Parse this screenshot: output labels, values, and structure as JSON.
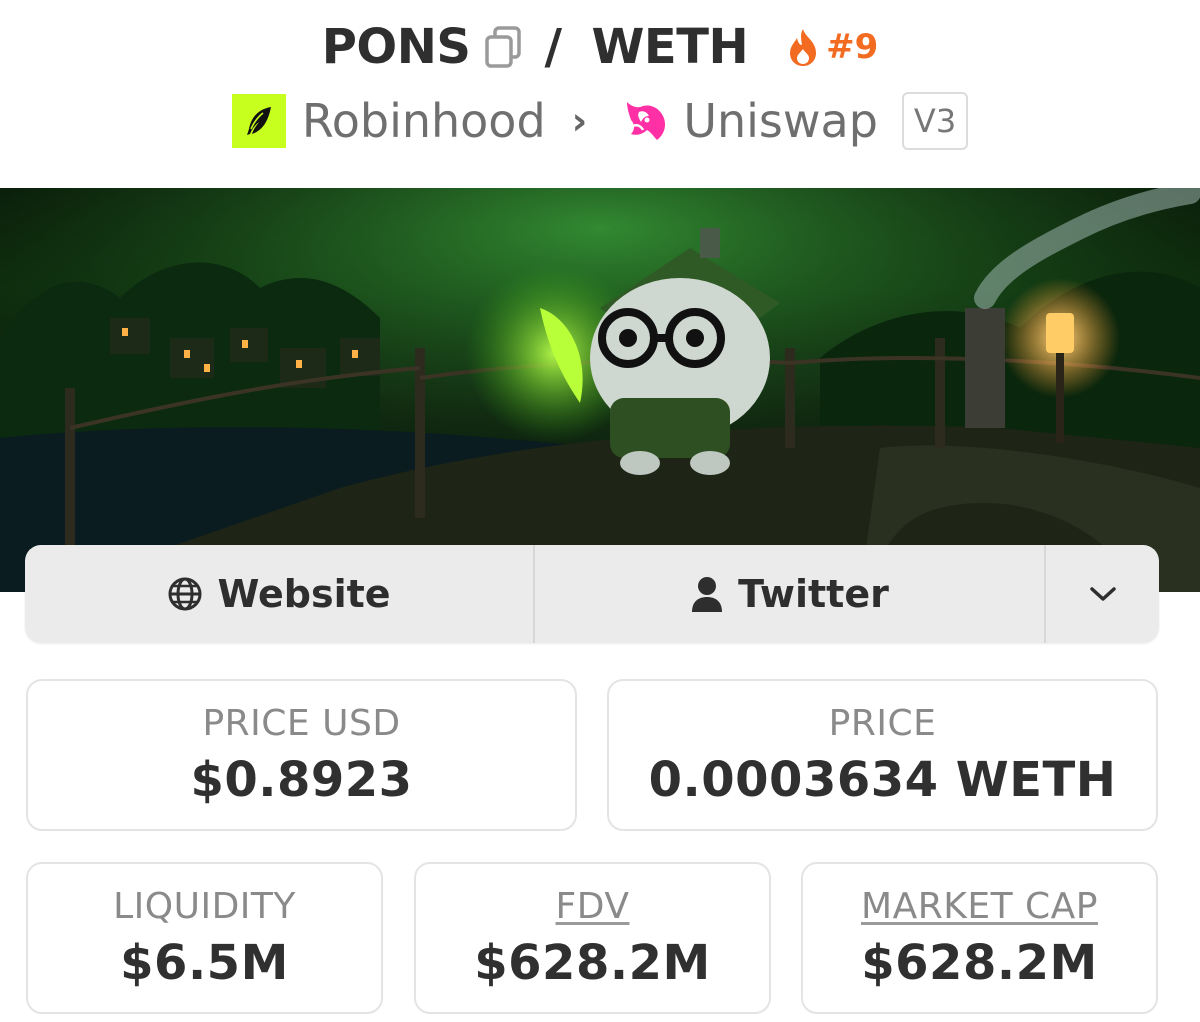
{
  "header": {
    "base_token": "PONS",
    "separator": "/",
    "quote_token": "WETH",
    "rank": "#9",
    "icons": {
      "copy": "copy-icon",
      "trending": "flame-icon"
    },
    "colors": {
      "rank": "#f26b21"
    }
  },
  "breadcrumb": {
    "chain": "Robinhood",
    "chain_logo": "robinhood-feather-logo",
    "dex": "Uniswap",
    "dex_logo": "uniswap-unicorn-logo",
    "version": "V3",
    "colors": {
      "chain_logo_bg": "#c7ff1f",
      "dex_logo": "#ff2fa6"
    }
  },
  "links": {
    "website_label": "Website",
    "website_icon": "globe-icon",
    "twitter_label": "Twitter",
    "twitter_icon": "user-icon",
    "more_icon": "chevron-down-icon"
  },
  "stats": {
    "price_usd": {
      "label": "PRICE USD",
      "value": "$0.8923"
    },
    "price": {
      "label": "PRICE",
      "value": "0.0003634 WETH"
    },
    "liquidity": {
      "label": "LIQUIDITY",
      "value": "$6.5M"
    },
    "fdv": {
      "label": "FDV",
      "value": "$628.2M"
    },
    "market_cap": {
      "label": "MARKET CAP",
      "value": "$628.2M"
    }
  }
}
